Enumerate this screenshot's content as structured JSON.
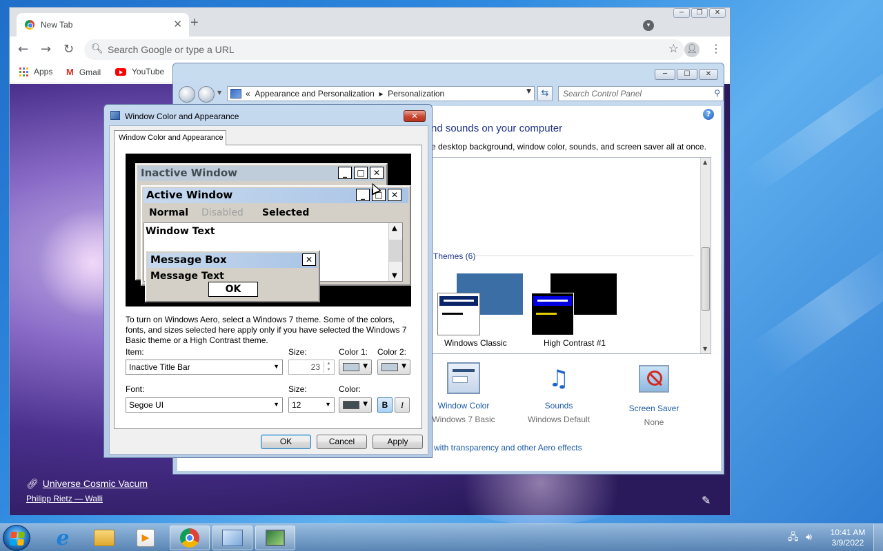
{
  "chrome": {
    "tab_title": "New Tab",
    "tab_close": "✕",
    "new_tab": "+",
    "omnibox_placeholder": "Search Google or type a URL",
    "bookmarks": [
      {
        "label": "Apps",
        "icon": "apps-grid-icon"
      },
      {
        "label": "Gmail",
        "icon": "gmail-icon"
      },
      {
        "label": "YouTube",
        "icon": "youtube-icon"
      }
    ],
    "background_title": "Universe Cosmic Vacum",
    "background_author": "Philipp Rietz — Walli"
  },
  "cpanel": {
    "breadcrumb_root": "Appearance and Personalization",
    "breadcrumb_leaf": "Personalization",
    "search_placeholder": "Search Control Panel",
    "heading": "nd sounds on your computer",
    "subheading": "e desktop background, window color, sounds, and screen saver all at once.",
    "themes_label": "Themes (6)",
    "themes": [
      {
        "name": "Windows Classic"
      },
      {
        "name": "High Contrast #1"
      }
    ],
    "bottom_items": [
      {
        "label": "Window Color",
        "value": "Windows 7 Basic",
        "icon": "window-color-icon"
      },
      {
        "label": "Sounds",
        "value": "Windows Default",
        "icon": "sounds-icon"
      },
      {
        "label": "Screen Saver",
        "value": "None",
        "icon": "screen-saver-icon"
      }
    ],
    "aero_link": "with transparency and other Aero effects"
  },
  "dialog": {
    "title": "Window Color and Appearance",
    "tab": "Window Color and Appearance",
    "preview": {
      "inactive_window": "Inactive Window",
      "active_window": "Active Window",
      "menu_normal": "Normal",
      "menu_disabled": "Disabled",
      "menu_selected": "Selected",
      "window_text": "Window Text",
      "message_box": "Message Box",
      "message_text": "Message Text",
      "ok": "OK"
    },
    "info": "To turn on Windows Aero, select a Windows 7 theme.  Some of the colors, fonts, and sizes selected here apply only if you have selected the Windows 7 Basic theme or a High Contrast theme.",
    "item_label": "Item:",
    "item_value": "Inactive Title Bar",
    "size_label": "Size:",
    "item_size": "23",
    "color1_label": "Color 1:",
    "color2_label": "Color 2:",
    "font_label": "Font:",
    "font_value": "Segoe UI",
    "font_size_label": "Size:",
    "font_size": "12",
    "font_color_label": "Color:",
    "bold_label": "B",
    "italic_label": "I",
    "ok": "OK",
    "cancel": "Cancel",
    "apply": "Apply",
    "colors": {
      "color1": "#bfcddb",
      "color2": "#bfcddb",
      "font_color": "#434e54"
    }
  },
  "taskbar": {
    "time": "10:41 AM",
    "date": "3/9/2022"
  }
}
